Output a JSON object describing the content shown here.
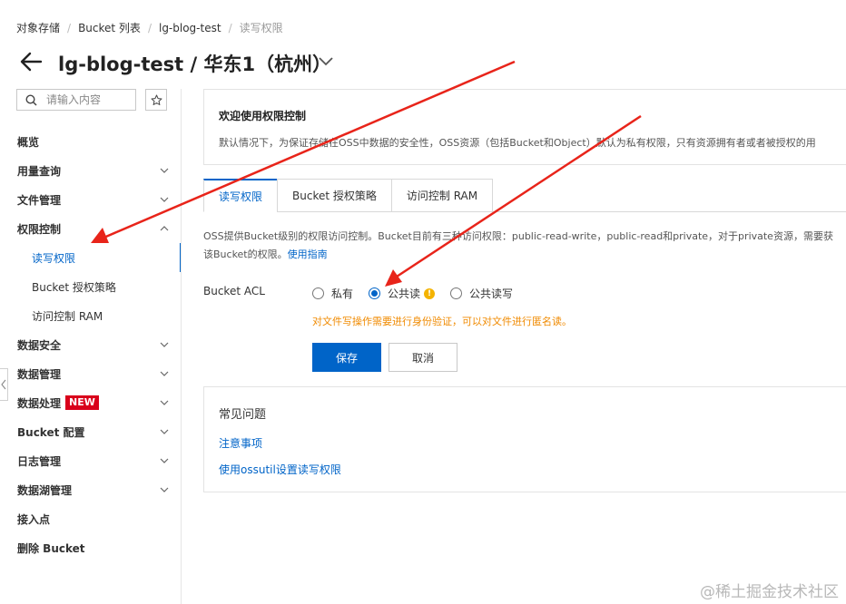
{
  "breadcrumb": [
    "对象存储",
    "Bucket 列表",
    "lg-blog-test",
    "读写权限"
  ],
  "header": {
    "title": "lg-blog-test / 华东1（杭州）"
  },
  "sidebar": {
    "search_placeholder": "请输入内容",
    "items": [
      {
        "label": "概览",
        "chevron": ""
      },
      {
        "label": "用量查询",
        "chevron": "down"
      },
      {
        "label": "文件管理",
        "chevron": "down"
      },
      {
        "label": "权限控制",
        "chevron": "up"
      },
      {
        "label": "读写权限",
        "chevron": "",
        "sub": true,
        "active": true
      },
      {
        "label": "Bucket 授权策略",
        "chevron": "",
        "sub": true
      },
      {
        "label": "访问控制 RAM",
        "chevron": "",
        "sub": true
      },
      {
        "label": "数据安全",
        "chevron": "down"
      },
      {
        "label": "数据管理",
        "chevron": "down"
      },
      {
        "label": "数据处理",
        "chevron": "down",
        "badge": "NEW"
      },
      {
        "label": "Bucket 配置",
        "chevron": "down"
      },
      {
        "label": "日志管理",
        "chevron": "down"
      },
      {
        "label": "数据湖管理",
        "chevron": "down"
      },
      {
        "label": "接入点",
        "chevron": ""
      },
      {
        "label": "删除 Bucket",
        "chevron": ""
      }
    ]
  },
  "welcome": {
    "title": "欢迎使用权限控制",
    "text": "默认情况下，为保证存储在OSS中数据的安全性，OSS资源（包括Bucket和Object）默认为私有权限，只有资源拥有者或者被授权的用"
  },
  "tabs": [
    "读写权限",
    "Bucket 授权策略",
    "访问控制 RAM"
  ],
  "description": {
    "line1": "OSS提供Bucket级别的权限访问控制。Bucket目前有三种访问权限：public-read-write，public-read和private，对于private资源，需要获",
    "line2": "该Bucket的权限。",
    "link": "使用指南"
  },
  "acl": {
    "label": "Bucket ACL",
    "options": [
      "私有",
      "公共读",
      "公共读写"
    ],
    "selected_index": 1,
    "warning": "对文件写操作需要进行身份验证，可以对文件进行匿名读。",
    "save_label": "保存",
    "cancel_label": "取消"
  },
  "faq": {
    "title": "常见问题",
    "links": [
      "注意事项",
      "使用ossutil设置读写权限"
    ]
  },
  "watermark": "@稀土掘金技术社区",
  "colors": {
    "primary": "#0064c8",
    "badge": "#d9001b",
    "warning": "#f08a00",
    "arrow": "#e8241a"
  }
}
